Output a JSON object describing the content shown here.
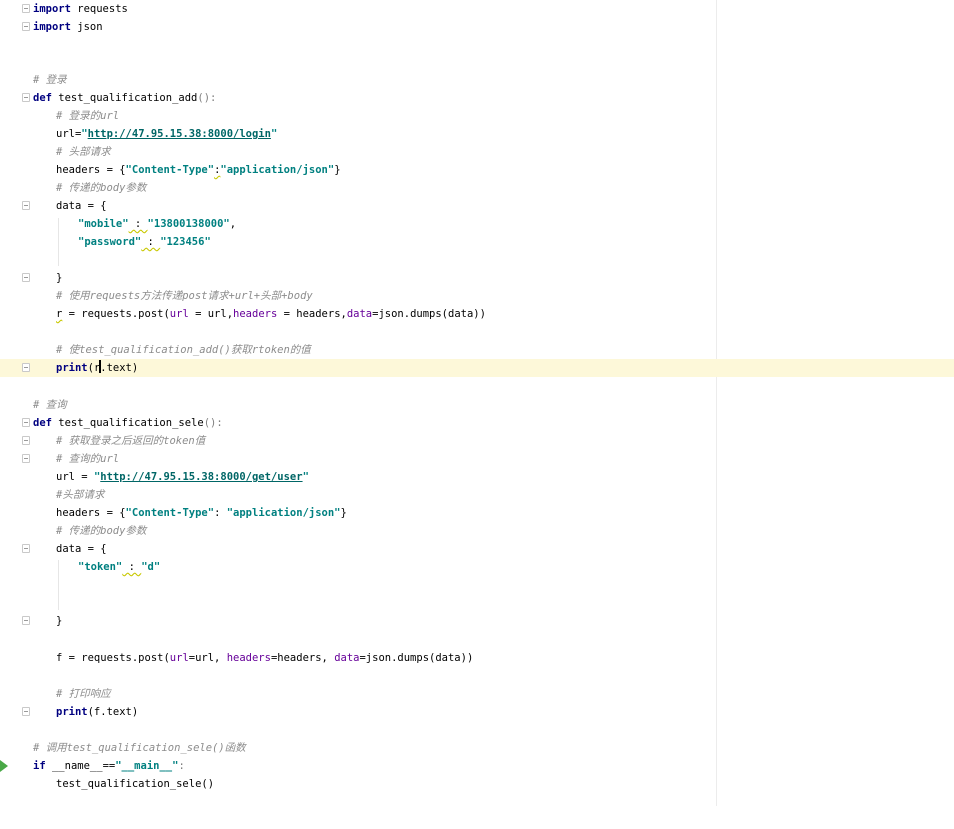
{
  "editor": {
    "lines": {
      "l1_kw": "import",
      "l1_rest": " requests",
      "l2_kw": "import",
      "l2_rest": " json",
      "l5_cmt": "# 登录",
      "l6_kw": "def",
      "l6_name": " test_qualification_add",
      "l6_paren": "():",
      "l7_cmt": "# 登录的url",
      "l8_a": "url=",
      "l8_q1": "\"",
      "l8_url": "http://47.95.15.38:8000/login",
      "l8_q2": "\"",
      "l9_cmt": "# 头部请求",
      "l10_a": "headers = {",
      "l10_s1": "\"Content-Type\"",
      "l10_c": ":",
      "l10_s2": "\"application/json\"",
      "l10_b": "}",
      "l11_cmt": "# 传递的body参数",
      "l12_a": "data = {",
      "l13_s1": "\"mobile\"",
      "l13_c": " : ",
      "l13_s2": "\"13800138000\"",
      "l13_e": ",",
      "l14_s1": "\"password\"",
      "l14_c": " : ",
      "l14_s2": "\"123456\"",
      "l16_a": "}",
      "l17_cmt": "# 使用requests方法传递post请求+url+头部+body",
      "l18_r": "r",
      "l18_a": " = requests.post(",
      "l18_p1": "url",
      "l18_b": " = url,",
      "l18_p2": "headers",
      "l18_c": " = headers,",
      "l18_p3": "data",
      "l18_d": "=json.dumps(data))",
      "l20_cmt": "# 使test_qualification_add()获取rtoken的值",
      "l21_kw": "print",
      "l21_a": "(r",
      "l21_b": ".text)",
      "l23_cmt": "# 查询",
      "l24_kw": "def",
      "l24_name": " test_qualification_sele",
      "l24_paren": "():",
      "l25_cmt": "# 获取登录之后返回的token值",
      "l26_cmt": "# 查询的url",
      "l27_a": "url = ",
      "l27_q1": "\"",
      "l27_url": "http://47.95.15.38:8000/get/user",
      "l27_q2": "\"",
      "l28_cmt": "#头部请求",
      "l29_a": "headers = {",
      "l29_s1": "\"Content-Type\"",
      "l29_c": ": ",
      "l29_s2": "\"application/json\"",
      "l29_b": "}",
      "l30_cmt": "# 传递的body参数",
      "l31_a": "data = {",
      "l32_s1": "\"token\"",
      "l32_c": " : ",
      "l32_s2": "\"d\"",
      "l35_a": "}",
      "l37_a": "f = requests.post(",
      "l37_p1": "url",
      "l37_b": "=url, ",
      "l37_p2": "headers",
      "l37_c": "=headers, ",
      "l37_p3": "data",
      "l37_d": "=json.dumps(data))",
      "l39_cmt": "# 打印响应",
      "l40_kw": "print",
      "l40_a": "(f.text)",
      "l42_cmt": "# 调用test_qualification_sele()函数",
      "l43_kw": "if",
      "l43_a": " __name__",
      "l43_b": "==",
      "l43_s": "\"__main__\"",
      "l43_c": ":",
      "l44_a": "test_qualification_sele()"
    },
    "colors": {
      "keyword": "#000080",
      "string": "#008080",
      "comment": "#8c8c8c",
      "current_line": "#fdf8d9",
      "run_marker": "#49a847"
    }
  }
}
